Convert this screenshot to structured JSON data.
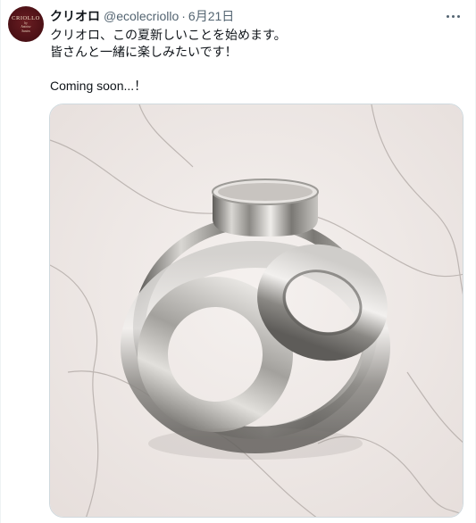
{
  "author": {
    "avatar_text_main": "CRIOLLO",
    "avatar_text_sub1": "by",
    "avatar_text_sub2": "Antoine",
    "avatar_text_sub3": "Santos",
    "display_name": "クリオロ",
    "handle": "@ecolecriollo",
    "separator": "·",
    "date": "6月21日"
  },
  "tweet": {
    "lines": [
      "クリオロ、この夏新しいことを始めます。",
      "皆さんと一緒に楽しみたいです！",
      "",
      "Coming soon...！"
    ]
  },
  "media": {
    "description_icon": "photo-of-stainless-steel-pastry-rings-on-marble",
    "colors": {
      "background": "#eee8e6",
      "vein": "#a9a29f",
      "metal_light": "#e8e6e3",
      "metal_dark": "#6e6c68"
    }
  },
  "icons": {
    "more": "more-horizontal-icon"
  }
}
